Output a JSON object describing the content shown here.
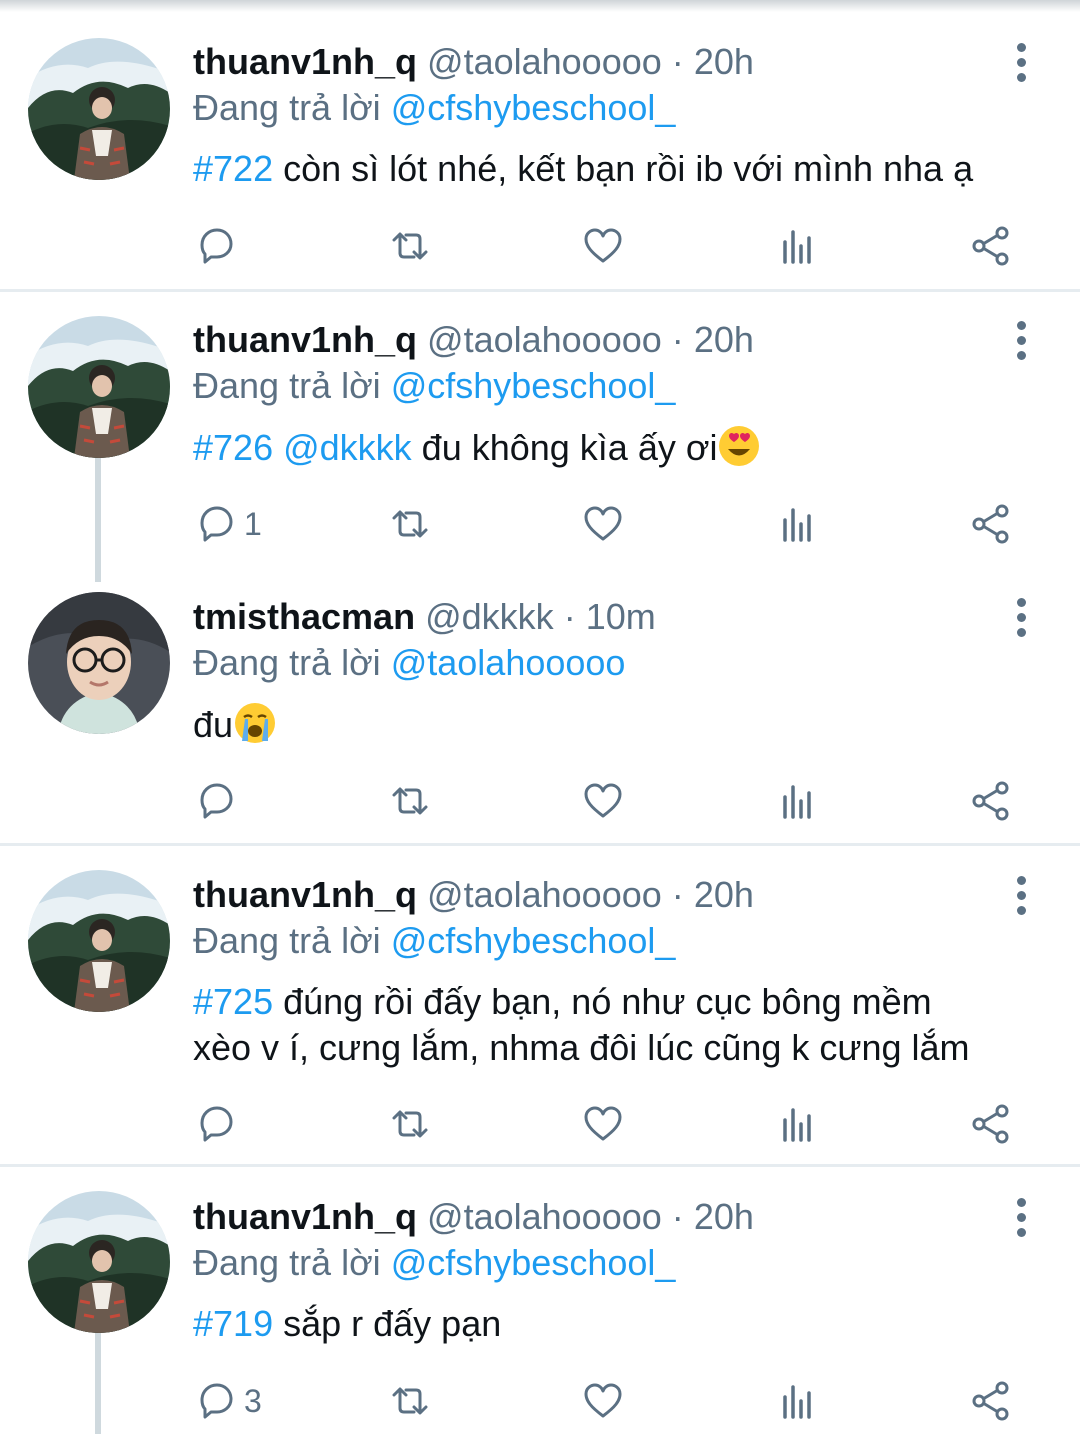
{
  "tweets": [
    {
      "name": "thuanv1nh_q",
      "handle": "@taolahooooo",
      "dot": "·",
      "time": "20h",
      "replying_prefix": "Đang trả lời",
      "replying_to": "@cfshybeschool_",
      "tag": "#722",
      "mention": "",
      "text": " còn sì lót nhé, kết bạn rồi ib với mình nha ạ",
      "text2": "",
      "reply_count": "",
      "emoji": ""
    },
    {
      "name": "thuanv1nh_q",
      "handle": "@taolahooooo",
      "dot": "·",
      "time": "20h",
      "replying_prefix": "Đang trả lời",
      "replying_to": "@cfshybeschool_",
      "tag": "#726",
      "mention": " @dkkkk",
      "text": " đu không kìa ấy ơi",
      "text2": "",
      "reply_count": "1",
      "emoji": "heart-eyes-emoji"
    },
    {
      "name": "tmisthacman",
      "handle": "@dkkkk",
      "dot": "·",
      "time": "10m",
      "replying_prefix": "Đang trả lời",
      "replying_to": "@taolahooooo",
      "tag": "",
      "mention": "",
      "text": "đu",
      "text2": "",
      "reply_count": "",
      "emoji": "crying-emoji"
    },
    {
      "name": "thuanv1nh_q",
      "handle": "@taolahooooo",
      "dot": "·",
      "time": "20h",
      "replying_prefix": "Đang trả lời",
      "replying_to": "@cfshybeschool_",
      "tag": "#725",
      "mention": "",
      "text": " đúng rồi đấy bạn, nó như cục bông mềm",
      "text2": "xèo v í, cưng lắm, nhma đôi lúc cũng k cưng lắm",
      "reply_count": "",
      "emoji": ""
    },
    {
      "name": "thuanv1nh_q",
      "handle": "@taolahooooo",
      "dot": "·",
      "time": "20h",
      "replying_prefix": "Đang trả lời",
      "replying_to": "@cfshybeschool_",
      "tag": "#719",
      "mention": "",
      "text": " sắp r đấy pạn",
      "text2": "",
      "reply_count": "3",
      "emoji": ""
    }
  ],
  "colors": {
    "accent": "#1d9bf0",
    "secondary_text": "#5b7083",
    "divider": "#e6ecf0"
  },
  "action_icons": [
    "reply-icon",
    "retweet-icon",
    "like-icon",
    "analytics-icon",
    "share-icon"
  ]
}
